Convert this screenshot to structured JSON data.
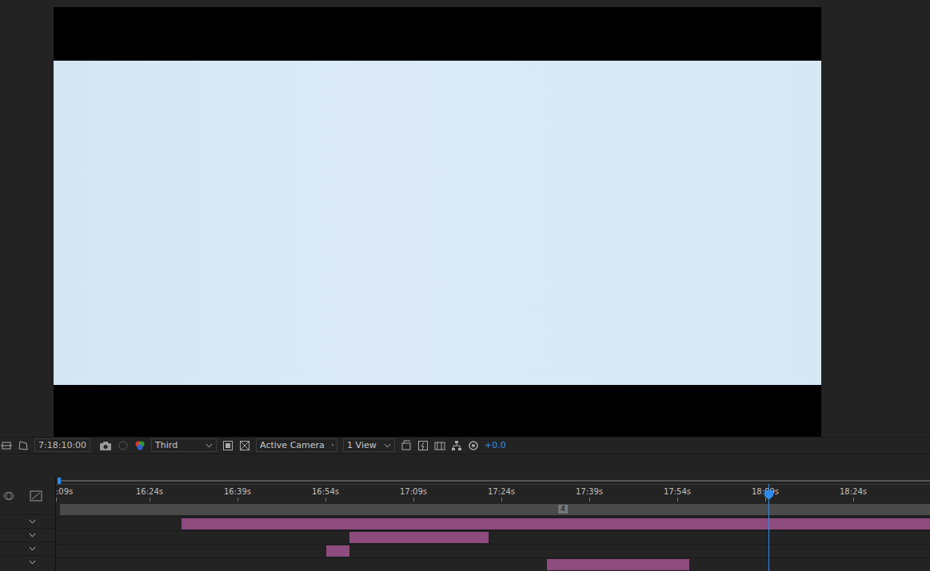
{
  "toolbar": {
    "timecode": "7:18:10:00",
    "resolution": "Third",
    "camera": "Active Camera",
    "views": "1 View",
    "exposure": "+0.0"
  },
  "timeline": {
    "ruler": [
      ":09s",
      "16:24s",
      "16:39s",
      "16:54s",
      "17:09s",
      "17:24s",
      "17:39s",
      "17:54s",
      "18:09s",
      "18:24s"
    ],
    "playhead": 0.815,
    "marker": {
      "label": "4",
      "level": 0.578
    },
    "layers": [
      {
        "start": 0.144,
        "end": 1.0,
        "expanded": false
      },
      {
        "start": 0.336,
        "end": 0.495,
        "expanded": false
      },
      {
        "start": 0.309,
        "end": 0.336,
        "expanded": false
      },
      {
        "start": 0.562,
        "end": 0.725,
        "expanded": false
      }
    ]
  }
}
